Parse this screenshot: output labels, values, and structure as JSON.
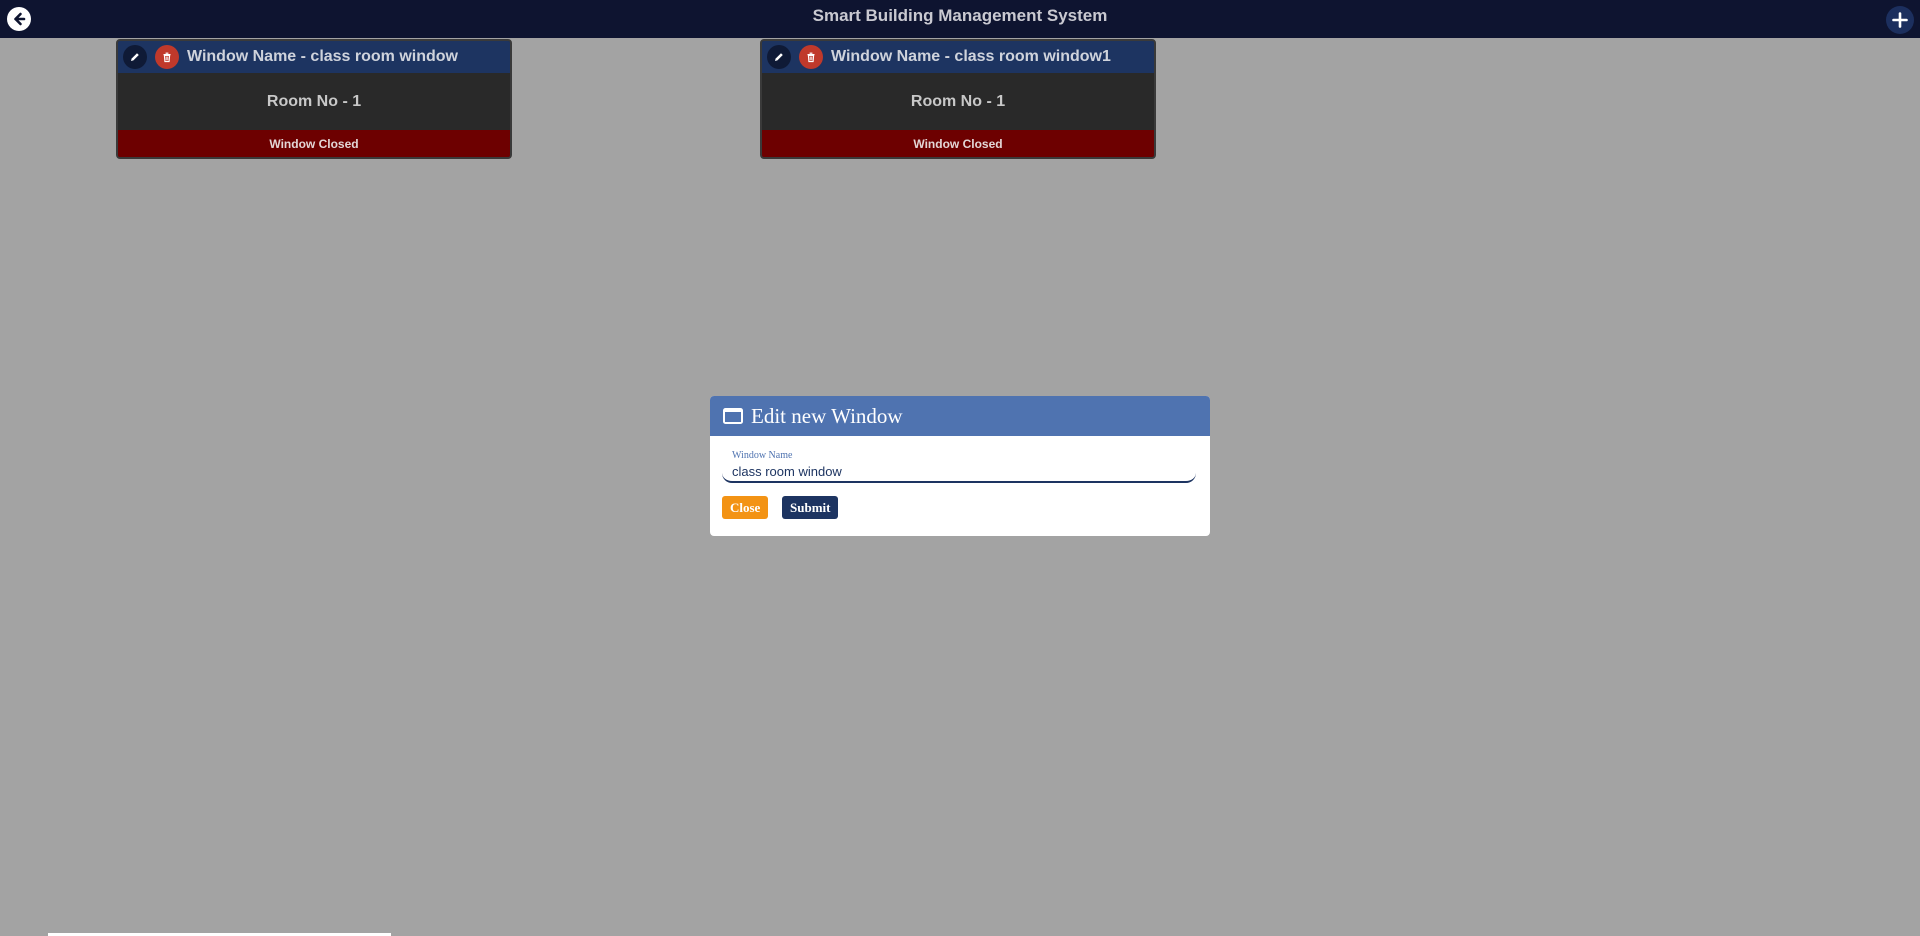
{
  "header": {
    "title": "Smart Building Management System",
    "back_icon": "arrow-left-circle-icon",
    "add_icon": "plus-icon"
  },
  "windows": [
    {
      "name": "Window Name - class room window",
      "room": "Room No - 1",
      "status": "Window Closed"
    },
    {
      "name": "Window Name - class room window1",
      "room": "Room No - 1",
      "status": "Window Closed"
    }
  ],
  "modal": {
    "title": "Edit new Window",
    "icon": "window-icon",
    "field_label": "Window Name",
    "field_value": "class room window",
    "close_label": "Close",
    "submit_label": "Submit"
  },
  "colors": {
    "background": "#a3a3a3",
    "topbar": "#0e1430",
    "card_header": "#1d3461",
    "status_closed": "#6d0000",
    "modal_header": "#4f73b0",
    "close_button": "#f39314",
    "submit_button": "#1d3461",
    "delete_icon_bg": "#c0392b"
  }
}
